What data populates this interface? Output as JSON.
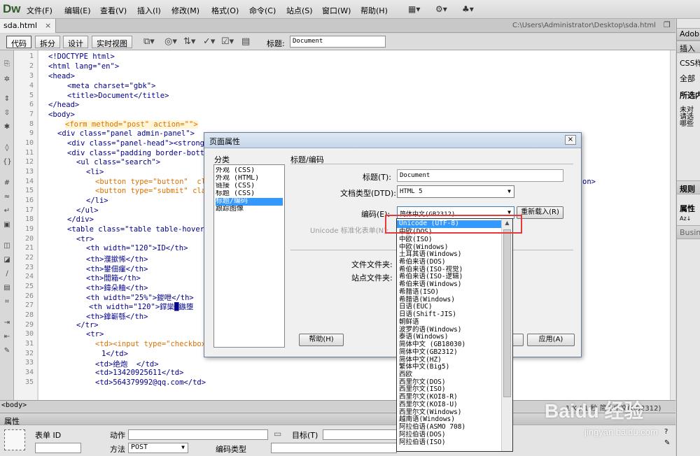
{
  "app": {
    "logo": "Dw"
  },
  "menu": [
    "文件(F)",
    "编辑(E)",
    "查看(V)",
    "插入(I)",
    "修改(M)",
    "格式(O)",
    "命令(C)",
    "站点(S)",
    "窗口(W)",
    "帮助(H)"
  ],
  "menu_icons": [
    "layout-icon",
    "gear-icon",
    "site-icon"
  ],
  "tab": {
    "filename": "sda.html",
    "close": "×",
    "path": "C:\\Users\\Administrator\\Desktop\\sda.html"
  },
  "views": [
    "代码",
    "拆分",
    "设计",
    "实时视图"
  ],
  "title_label": "标题:",
  "title_value": "Document",
  "line_numbers": [
    "1",
    "2",
    "3",
    "4",
    "5",
    "6",
    "7",
    "8",
    "9",
    "10",
    "11",
    "12",
    "13",
    "14",
    "15",
    "16",
    "17",
    "18",
    "19",
    "20",
    "21",
    "22",
    "23",
    "24",
    "25",
    "26",
    "27",
    "28",
    "29",
    "30",
    "31",
    "32",
    "33",
    "34",
    "35"
  ],
  "code": {
    "l1": "<!DOCTYPE html>",
    "l2": "<html lang=\"en\">",
    "l3": "<head>",
    "l4": "<meta charset=\"gbk\">",
    "l5": "<title>Document</title>",
    "l6": "</head>",
    "l7": "<body>",
    "l8": "<form method=\"post\" action=\"\">",
    "l9": "<div class=\"panel admin-panel\">",
    "l10": "<div class=\"panel-head\"><strong",
    "l11": "<div class=\"padding border-bott",
    "l12": "<ul class=\"search\">",
    "l13": "<li>",
    "l14": "<button type=\"button\"  cl",
    "l15": "<button type=\"submit\" cla",
    "l16": "</li>",
    "l17": "</ul>",
    "l18": "</div>",
    "l19": "<table class=\"table table-hover",
    "l20": "<tr>",
    "l21": "<th width=\"120\">ID</th>",
    "l22": "<th>濮撳悕</th>",
    "l23": "<th>鐢佃瘽</th>",
    "l24": "<th>閭箱</th>",
    "l25": "<th>鍏朵粬</th>",
    "l26": "<th width=\"25%\">鍐呭</th>",
    "l27": "<th width=\"120\">鐣欒█鏃堕",
    "l28": "<th>鎿嶄綔</th>",
    "l29": "</tr>",
    "l30": "<tr>",
    "l31": "<td><input type=\"checkbox",
    "l32": "1</td>",
    "l33": "<td>绝炮  </td>",
    "l34": "<td>13420925611</td>",
    "l35": "<td>564379992@qq.com</td>",
    "l14_tail": "on>"
  },
  "status": {
    "tag": "<body>",
    "right": "1 K / 1 秒  简体中文(GB2312)"
  },
  "properties": {
    "title": "属性",
    "form_id_label": "表单 ID",
    "action_label": "动作",
    "target_label": "目标(T)",
    "method_label": "方法",
    "method_value": "POST",
    "enctype_label": "编码类型"
  },
  "right_panel": {
    "adobe": "Adob",
    "insert": "插入",
    "css": "CSS样",
    "all": "全部",
    "selected": "所选内",
    "hint1": "未对",
    "hint2": "请选",
    "hint3": "哪些",
    "rules": "规则",
    "attrs": "属性",
    "biz": "Busin"
  },
  "dialog": {
    "title": "页面属性",
    "close": "×",
    "category_label": "分类",
    "categories": [
      "外观 (CSS)",
      "外观 (HTML)",
      "链接 (CSS)",
      "标题 (CSS)",
      "标题/编码",
      "跟踪图像"
    ],
    "selected_category": 4,
    "section_title": "标题/编码",
    "title_label": "标题(T):",
    "title_value": "Document",
    "doctype_label": "文档类型(DTD):",
    "doctype_value": "HTML 5",
    "encoding_label": "编码(E):",
    "encoding_value": "简体中文(GB2312)",
    "reload_button": "重新载入(R)",
    "unicode_label": "Unicode 标准化表单(N):",
    "folder_label": "文件文件夹:",
    "site_folder_label": "站点文件夹:",
    "help_button": "帮助(H)",
    "apply_button": "应用(A)"
  },
  "encoding_options": [
    "Unicode (UTF-8)",
    "中欧(DOS)",
    "中欧(ISO)",
    "中欧(Windows)",
    "土耳其语(Windows)",
    "希伯来语(DOS)",
    "希伯来语(ISO-视觉)",
    "希伯来语(ISO-逻辑)",
    "希伯来语(Windows)",
    "希腊语(ISO)",
    "希腊语(Windows)",
    "日语(EUC)",
    "日语(Shift-JIS)",
    "朝鲜语",
    "波罗的语(Windows)",
    "泰语(Windows)",
    "简体中文 (GB18030)",
    "简体中文(GB2312)",
    "简体中文(HZ)",
    "繁体中文(Big5)",
    "西欧",
    "西里尔文(DOS)",
    "西里尔文(ISO)",
    "西里尔文(KOI8-R)",
    "西里尔文(KOI8-U)",
    "西里尔文(Windows)",
    "越南语(Windows)",
    "阿拉伯语(ASMO 708)",
    "阿拉伯语(DOS)",
    "阿拉伯语(ISO)"
  ],
  "highlighted_option": 0,
  "watermark": {
    "logo": "Baidu 经验",
    "url": "jingyan.baidu.com"
  },
  "colors": {
    "tag": "#00008b",
    "string": "#0000cc",
    "form_tag": "#e07000",
    "selection": "#3399ff",
    "highlight_box": "#e53a3a"
  }
}
